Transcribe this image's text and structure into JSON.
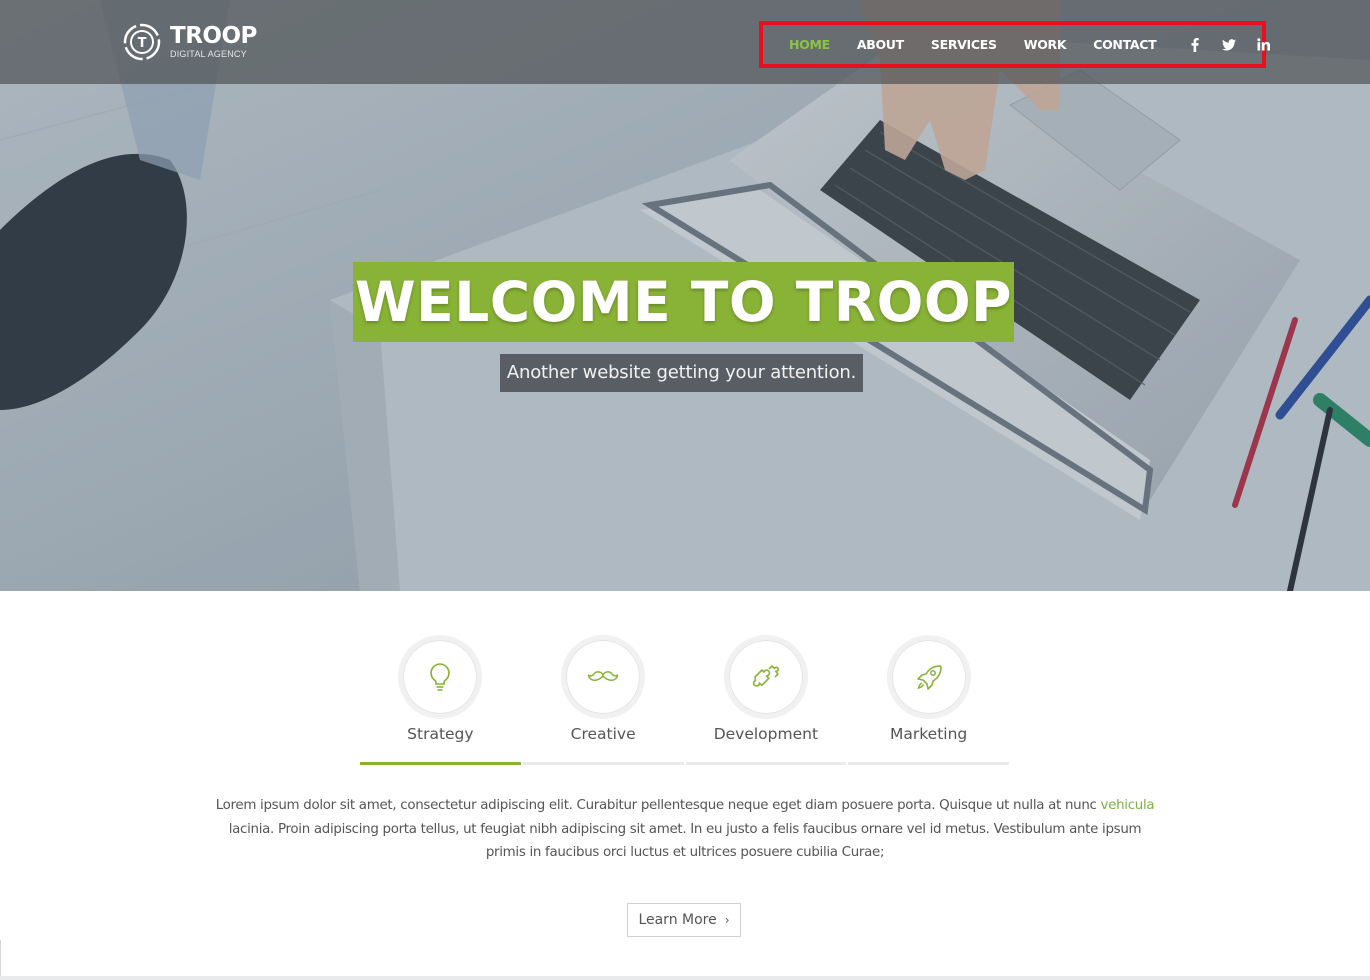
{
  "brand": {
    "name": "TROOP",
    "tagline": "DIGITAL AGENCY",
    "logo_icon": "troop-logo-icon"
  },
  "nav": {
    "items": [
      {
        "label": "HOME",
        "active": true
      },
      {
        "label": "ABOUT",
        "active": false
      },
      {
        "label": "SERVICES",
        "active": false
      },
      {
        "label": "WORK",
        "active": false
      },
      {
        "label": "CONTACT",
        "active": false
      }
    ],
    "social": [
      {
        "icon": "facebook-icon"
      },
      {
        "icon": "twitter-icon"
      },
      {
        "icon": "linkedin-icon"
      }
    ],
    "highlight_color": "#e8101e"
  },
  "hero": {
    "title": "WELCOME TO TROOP",
    "subtitle": "Another website getting your attention."
  },
  "services": {
    "tabs": [
      {
        "label": "Strategy",
        "icon": "lightbulb-icon",
        "active": true
      },
      {
        "label": "Creative",
        "icon": "mustache-icon",
        "active": false
      },
      {
        "label": "Development",
        "icon": "puzzle-icon",
        "active": false
      },
      {
        "label": "Marketing",
        "icon": "rocket-icon",
        "active": false
      }
    ],
    "description_before": "Lorem ipsum dolor sit amet, consectetur adipiscing elit. Curabitur pellentesque neque eget diam posuere porta. Quisque ut nulla at nunc",
    "description_link": "vehicula",
    "description_after": "lacinia. Proin adipiscing porta tellus, ut feugiat nibh adipiscing sit amet. In eu justo a felis faucibus ornare vel id metus. Vestibulum ante ipsum primis in faucibus orci luctus et ultrices posuere cubilia Curae;",
    "button_label": "Learn More",
    "button_chevron": "›"
  },
  "colors": {
    "accent": "#89b336",
    "nav_active": "#8bc34a",
    "link": "#7cb342"
  }
}
